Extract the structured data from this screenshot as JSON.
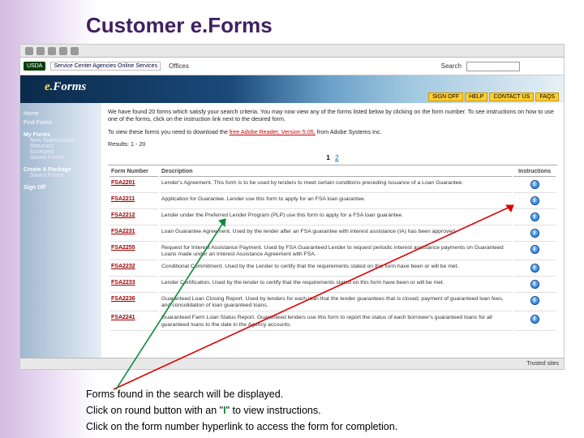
{
  "slide": {
    "title": "Customer e.Forms",
    "annotations": [
      "Forms found in the search will be displayed.",
      "Click on round button with an \"I\" to view instructions.",
      "Click on the form number hyperlink to access the form for completion."
    ],
    "i_char": "I"
  },
  "header": {
    "usda": "USDA",
    "sca": "Service Center Agencies Online Services",
    "offices": "Offices",
    "search_label": "Search",
    "banner_logo": "e.Forms",
    "banner_buttons": [
      "SIGN OFF",
      "HELP",
      "CONTACT US",
      "FAQS"
    ]
  },
  "sidebar": {
    "items_top": [
      "Home",
      "Find Forms"
    ],
    "section_myforms": "My Forms",
    "myforms_items": [
      "New Submissions",
      "Returned",
      "Accepted",
      "Saved Forms"
    ],
    "create_pkg": "Create A Package",
    "saved_pkg": "Saved Forms",
    "signoff": "Sign Off"
  },
  "main": {
    "intro": "We have found 20 forms which satisfy your search criteria. You may now view any of the forms listed below by clicking on the form number. To see instructions on how to use one of the forms, click on the instruction link next to the desired form.",
    "reader_pre": "To view these forms you need to download the ",
    "reader_link": "free Adobe Reader, Version 5.05,",
    "reader_post": " from Adobe Systems Inc.",
    "results": "Results: 1 - 20",
    "pager": {
      "p1": "1",
      "p2": "2"
    },
    "columns": {
      "form": "Form Number",
      "desc": "Description",
      "instr": "Instructions"
    },
    "rows": [
      {
        "num": "FSA2201",
        "desc": "Lender's Agreement. This form is to be used by lenders to meet certain conditions preceding issuance of a Loan Guarantee."
      },
      {
        "num": "FSA2211",
        "desc": "Application for Guarantee. Lender use this form to apply for an FSA loan guarantee."
      },
      {
        "num": "FSA2212",
        "desc": "Lender under the Preferred Lender Program (PLP) use this form to apply for a FSA loan guarantee."
      },
      {
        "num": "FSA2231",
        "desc": "Loan Guarantee Agreement. Used by the lender after an FSA guarantee with interest assistance (IA) has been approved."
      },
      {
        "num": "FSA2255",
        "desc": "Request for Interest Assistance Payment. Used by FSA Guaranteed Lender to request periodic interest assistance payments on Guaranteed Loans made under an Interest Assistance Agreement with FSA."
      },
      {
        "num": "FSA2232",
        "desc": "Conditional Commitment. Used by the Lender to certify that the requirements stated on this form have been or will be met."
      },
      {
        "num": "FSA2233",
        "desc": "Lender Certification. Used by the lender to certify that the requirements stated on this form have been or will be met."
      },
      {
        "num": "FSA2236",
        "desc": "Guaranteed Loan Closing Report. Used by lenders for each loan that the lender guarantees that is closed, payment of guaranteed loan fees, and consolidation of loan guaranteed loans."
      },
      {
        "num": "FSA2241",
        "desc": "Guaranteed Farm Loan Status Report. Guaranteed lenders use this form to report the status of each borrower's guaranteed loans for all guaranteed loans to the date in the Agency accounts."
      }
    ]
  },
  "statusbar": "Trusted sites"
}
